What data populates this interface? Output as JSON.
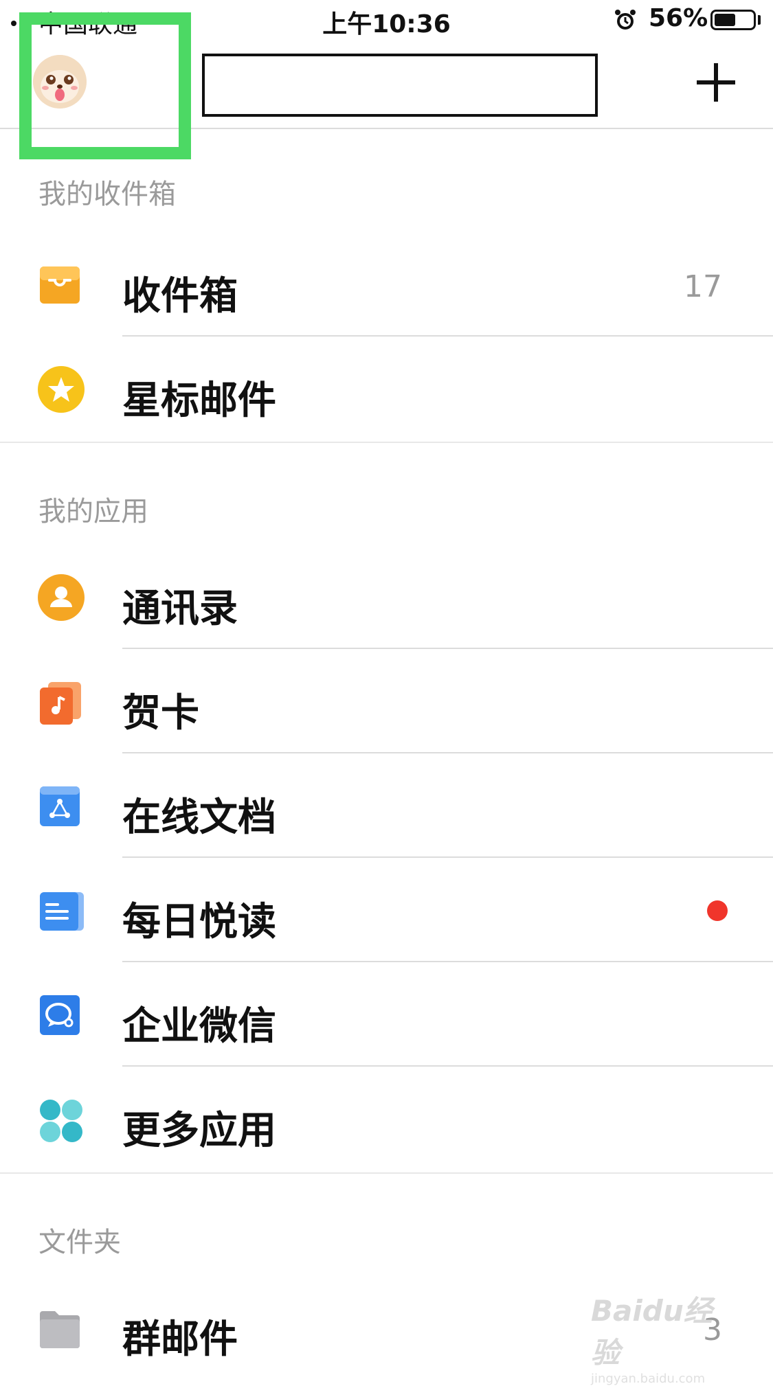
{
  "status_bar": {
    "carrier": "中国联通",
    "time": "上午10:36",
    "battery_percent": "56%",
    "battery_level": 0.56
  },
  "header": {
    "avatar_icon": "cartoon-dog-avatar",
    "add_icon": "plus-icon"
  },
  "sections": {
    "inbox_header": "我的收件箱",
    "apps_header": "我的应用",
    "folders_header": "文件夹"
  },
  "inbox_items": [
    {
      "label": "收件箱",
      "count": "17",
      "icon": "inbox-tray-icon",
      "color": "#f5a623"
    },
    {
      "label": "星标邮件",
      "count": "",
      "icon": "star-icon",
      "color": "#f7c31a"
    }
  ],
  "app_items": [
    {
      "label": "通讯录",
      "icon": "contacts-icon",
      "color": "#f5a623"
    },
    {
      "label": "贺卡",
      "icon": "greeting-card-icon",
      "color": "#f26b2e"
    },
    {
      "label": "在线文档",
      "icon": "online-doc-icon",
      "color": "#3d8ef0"
    },
    {
      "label": "每日悦读",
      "icon": "daily-read-icon",
      "color": "#3d8ef0",
      "has_badge": true
    },
    {
      "label": "企业微信",
      "icon": "wecom-icon",
      "color": "#2d7de8"
    },
    {
      "label": "更多应用",
      "icon": "more-apps-icon",
      "color": "#3cc1c8"
    }
  ],
  "folder_items": [
    {
      "label": "群邮件",
      "count": "3",
      "icon": "folder-icon",
      "color": "#a9a9ad"
    }
  ],
  "watermark": {
    "text": "Baidu经验",
    "sub": "jingyan.baidu.com"
  }
}
